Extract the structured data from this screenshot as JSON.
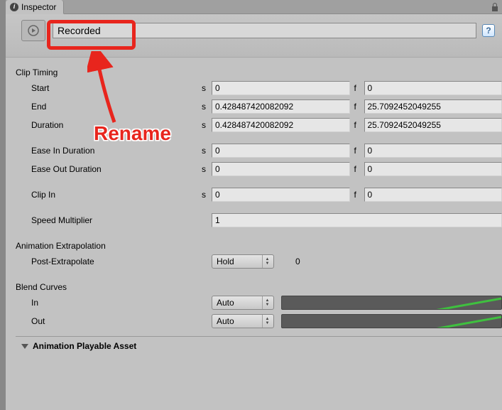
{
  "tab": {
    "label": "Inspector"
  },
  "header": {
    "name": "Recorded"
  },
  "sections": {
    "clipTiming": {
      "title": "Clip Timing",
      "rows": {
        "start": {
          "label": "Start",
          "unit_s": "s",
          "val_s": "0",
          "unit_f": "f",
          "val_f": "0"
        },
        "end": {
          "label": "End",
          "unit_s": "s",
          "val_s": "0.428487420082092",
          "unit_f": "f",
          "val_f": "25.7092452049255"
        },
        "duration": {
          "label": "Duration",
          "unit_s": "s",
          "val_s": "0.428487420082092",
          "unit_f": "f",
          "val_f": "25.7092452049255"
        },
        "easeIn": {
          "label": "Ease In Duration",
          "unit_s": "s",
          "val_s": "0",
          "unit_f": "f",
          "val_f": "0"
        },
        "easeOut": {
          "label": "Ease Out Duration",
          "unit_s": "s",
          "val_s": "0",
          "unit_f": "f",
          "val_f": "0"
        },
        "clipIn": {
          "label": "Clip In",
          "unit_s": "s",
          "val_s": "0",
          "unit_f": "f",
          "val_f": "0"
        },
        "speed": {
          "label": "Speed Multiplier",
          "val": "1"
        }
      }
    },
    "extrapolation": {
      "title": "Animation Extrapolation",
      "post": {
        "label": "Post-Extrapolate",
        "mode": "Hold",
        "extra": "0"
      }
    },
    "blend": {
      "title": "Blend Curves",
      "in": {
        "label": "In",
        "mode": "Auto"
      },
      "out": {
        "label": "Out",
        "mode": "Auto"
      }
    },
    "asset": {
      "title": "Animation Playable Asset"
    }
  },
  "annotation": {
    "text": "Rename"
  }
}
